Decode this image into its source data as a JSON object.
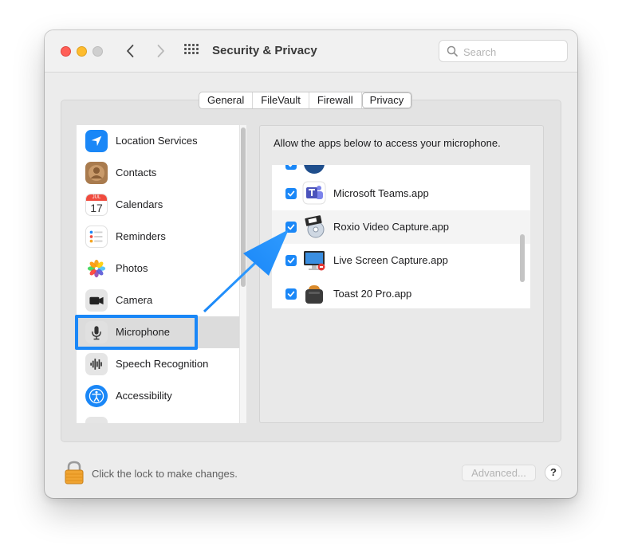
{
  "window": {
    "title": "Security & Privacy",
    "search_placeholder": "Search"
  },
  "tabs": [
    {
      "label": "General",
      "selected": false
    },
    {
      "label": "FileVault",
      "selected": false
    },
    {
      "label": "Firewall",
      "selected": false
    },
    {
      "label": "Privacy",
      "selected": true
    }
  ],
  "sidebar": {
    "items": [
      {
        "label": "Location Services",
        "icon": "location-arrow-icon",
        "selected": false
      },
      {
        "label": "Contacts",
        "icon": "contacts-icon",
        "selected": false
      },
      {
        "label": "Calendars",
        "icon": "calendar-icon",
        "selected": false,
        "icon_month": "JUL",
        "icon_day": "17"
      },
      {
        "label": "Reminders",
        "icon": "reminders-icon",
        "selected": false
      },
      {
        "label": "Photos",
        "icon": "photos-icon",
        "selected": false
      },
      {
        "label": "Camera",
        "icon": "camera-icon",
        "selected": false
      },
      {
        "label": "Microphone",
        "icon": "microphone-icon",
        "selected": true
      },
      {
        "label": "Speech Recognition",
        "icon": "speech-waveform-icon",
        "selected": false
      },
      {
        "label": "Accessibility",
        "icon": "accessibility-icon",
        "selected": false
      }
    ]
  },
  "main": {
    "description": "Allow the apps below to access your microphone.",
    "apps": [
      {
        "label": "Microsoft Teams.app",
        "checked": true,
        "icon": "teams-icon"
      },
      {
        "label": "Roxio Video Capture.app",
        "checked": true,
        "icon": "video-capture-icon"
      },
      {
        "label": "Live Screen Capture.app",
        "checked": true,
        "icon": "screen-capture-icon"
      },
      {
        "label": "Toast 20 Pro.app",
        "checked": true,
        "icon": "toast-icon"
      }
    ]
  },
  "footer": {
    "lock_label": "Click the lock to make changes.",
    "advanced_label": "Advanced...",
    "help_label": "?"
  },
  "colors": {
    "accent": "#1a87f7",
    "annotation": "#1a87f7"
  }
}
